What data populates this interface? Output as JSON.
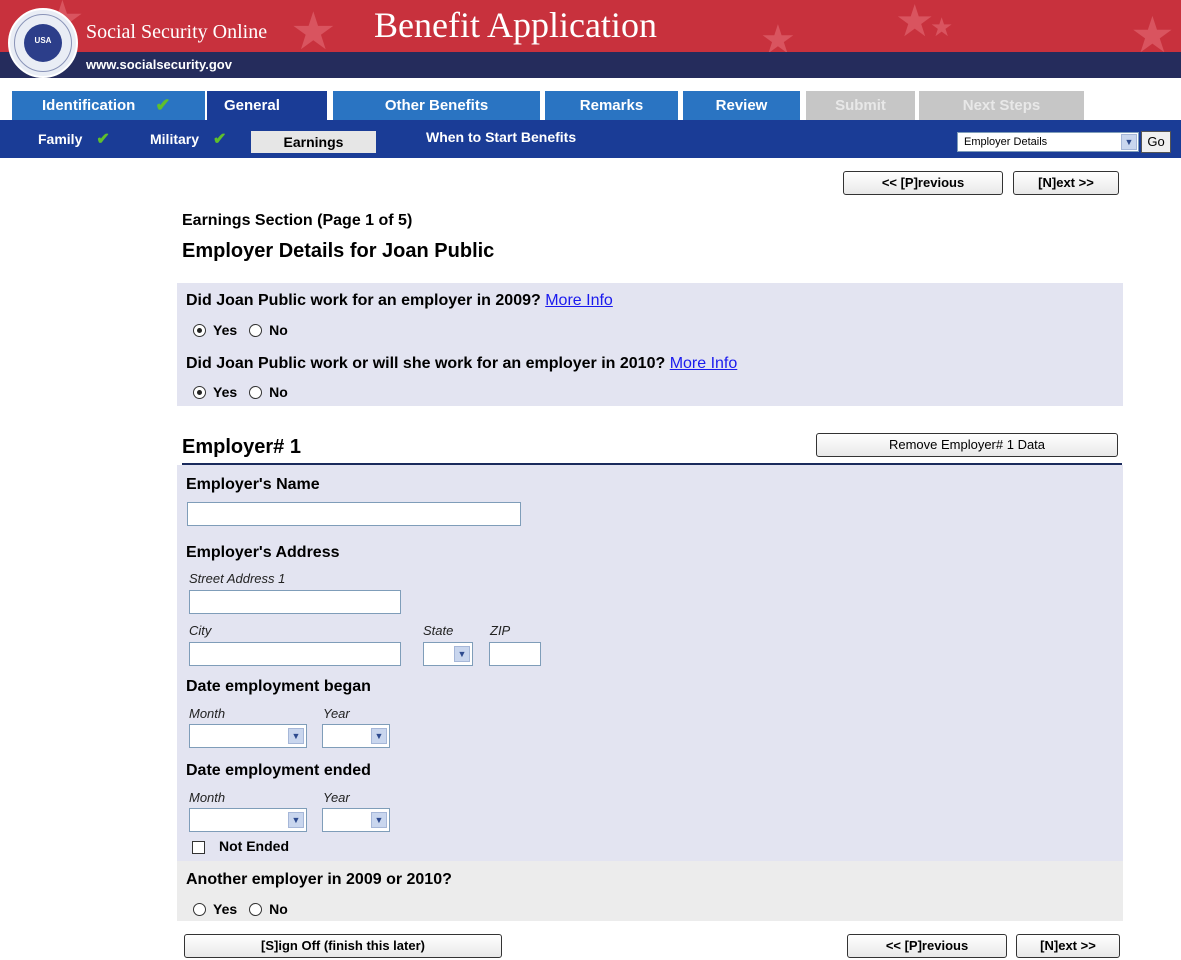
{
  "header": {
    "site_name": "Social Security Online",
    "app_title": "Benefit Application",
    "site_url": "www.socialsecurity.gov",
    "seal_text": "USA"
  },
  "main_tabs": [
    {
      "label": "Identification",
      "state": "complete"
    },
    {
      "label": "General",
      "state": "active"
    },
    {
      "label": "Other Benefits",
      "state": "available"
    },
    {
      "label": "Remarks",
      "state": "available"
    },
    {
      "label": "Review",
      "state": "available"
    },
    {
      "label": "Submit",
      "state": "disabled"
    },
    {
      "label": "Next Steps",
      "state": "disabled"
    }
  ],
  "sub_tabs": [
    {
      "label": "Family",
      "state": "complete"
    },
    {
      "label": "Military",
      "state": "complete"
    },
    {
      "label": "Earnings",
      "state": "active"
    },
    {
      "label": "When to Start Benefits",
      "state": "available"
    }
  ],
  "page_nav": {
    "selected": "Employer Details",
    "go_label": "Go"
  },
  "nav_buttons": {
    "previous": "<< [P]revious",
    "next": "[N]ext >>",
    "sign_off": "[S]ign Off (finish this later)"
  },
  "page": {
    "section": "Earnings Section (Page 1 of 5)",
    "title": "Employer Details for Joan Public"
  },
  "questions": {
    "q2009": "Did Joan Public work for an employer in 2009?",
    "q2010": "Did Joan Public work or will she work for an employer in 2010?",
    "more_info": "More Info",
    "yes": "Yes",
    "no": "No",
    "q2009_answer": "Yes",
    "q2010_answer": "Yes"
  },
  "employer": {
    "heading": "Employer# 1",
    "remove_button": "Remove Employer# 1 Data",
    "name_label": "Employer's Name",
    "name_value": "",
    "address_label": "Employer's Address",
    "street_label": "Street Address 1",
    "city_label": "City",
    "state_label": "State",
    "zip_label": "ZIP",
    "began_label": "Date employment began",
    "ended_label": "Date employment ended",
    "month_label": "Month",
    "year_label": "Year",
    "not_ended_label": "Not Ended",
    "not_ended_checked": false
  },
  "another": {
    "question": "Another employer in 2009 or 2010?",
    "answer": ""
  },
  "colors": {
    "banner_red": "#c8313d",
    "banner_navy": "#252c5c",
    "tab_blue": "#2a74c2",
    "tab_active": "#1a3c96",
    "panel": "#e3e4f1"
  },
  "icons": [
    "seal-logo",
    "star-decoration",
    "checkmark-icon",
    "chevron-down-icon"
  ]
}
